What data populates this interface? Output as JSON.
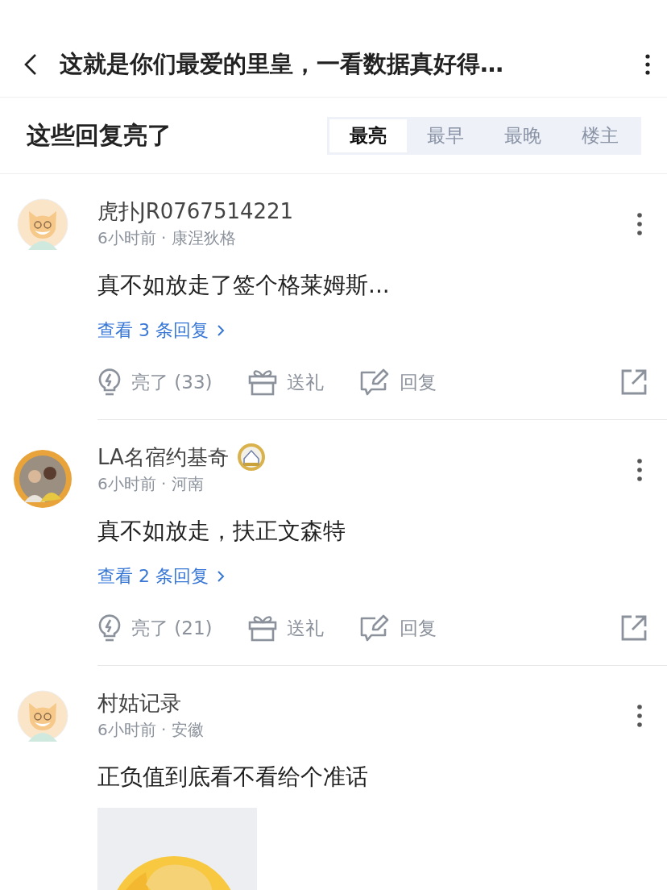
{
  "header": {
    "title": "这就是你们最爱的里皇，一看数据真好得…"
  },
  "sort_bar": {
    "heading": "这些回复亮了",
    "tabs": [
      {
        "label": "最亮",
        "selected": true
      },
      {
        "label": "最早",
        "selected": false
      },
      {
        "label": "最晚",
        "selected": false
      },
      {
        "label": "楼主",
        "selected": false
      }
    ]
  },
  "comments": [
    {
      "avatar": {
        "kind": "cat"
      },
      "name": "虎扑JR0767514221",
      "badge": false,
      "meta": "6小时前 · 康涅狄格",
      "text": "真不如放走了签个格莱姆斯...",
      "replies_link": "查看 3 条回复",
      "actions": {
        "like": "亮了 (33)",
        "gift": "送礼",
        "reply": "回复"
      }
    },
    {
      "name": "LA名宿约基奇",
      "badge": true,
      "meta": "6小时前 · 河南",
      "text": "真不如放走，扶正文森特",
      "replies_link": "查看 2 条回复",
      "actions": {
        "like": "亮了 (21)",
        "gift": "送礼",
        "reply": "回复"
      }
    },
    {
      "avatar": {
        "kind": "cat"
      },
      "name": "村姑记录",
      "badge": false,
      "meta": "6小时前 · 安徽",
      "text": "正负值到底看不看给个准话"
    }
  ]
}
